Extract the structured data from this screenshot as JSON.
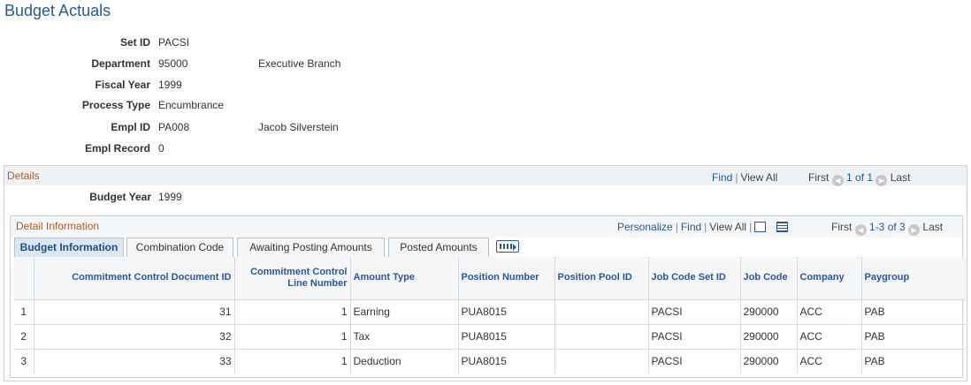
{
  "page": {
    "title": "Budget Actuals"
  },
  "fields": [
    {
      "label": "Set ID",
      "value": "PACSI",
      "desc": ""
    },
    {
      "label": "Department",
      "value": "95000",
      "desc": "Executive Branch"
    },
    {
      "label": "Fiscal Year",
      "value": "1999",
      "desc": ""
    },
    {
      "label": "Process Type",
      "value": "Encumbrance",
      "desc": ""
    },
    {
      "label": "Empl ID",
      "value": "PA008",
      "desc": "Jacob Silverstein"
    },
    {
      "label": "Empl Record",
      "value": "0",
      "desc": ""
    }
  ],
  "details": {
    "title": "Details",
    "find": "Find",
    "view_all": "View All",
    "first": "First",
    "range": "1 of 1",
    "last": "Last",
    "budget_year_label": "Budget Year",
    "budget_year_value": "1999"
  },
  "detail_info": {
    "title": "Detail Information",
    "personalize": "Personalize",
    "find": "Find",
    "view_all": "View All",
    "first": "First",
    "range": "1-3 of 3",
    "last": "Last"
  },
  "tabs": [
    {
      "label": "Budget Information",
      "active": true
    },
    {
      "label": "Combination Code",
      "active": false
    },
    {
      "label": "Awaiting Posting Amounts",
      "active": false
    },
    {
      "label": "Posted Amounts",
      "active": false
    }
  ],
  "table": {
    "headers": [
      "",
      "Commitment Control Document ID",
      "Commitment Control Line Number",
      "Amount Type",
      "Position Number",
      "Position Pool ID",
      "Job Code Set ID",
      "Job Code",
      "Company",
      "Paygroup"
    ],
    "rows": [
      [
        "1",
        "31",
        "1",
        "Earning",
        "PUA8015",
        "",
        "PACSI",
        "290000",
        "ACC",
        "PAB"
      ],
      [
        "2",
        "32",
        "1",
        "Tax",
        "PUA8015",
        "",
        "PACSI",
        "290000",
        "ACC",
        "PAB"
      ],
      [
        "3",
        "33",
        "1",
        "Deduction",
        "PUA8015",
        "",
        "PACSI",
        "290000",
        "ACC",
        "PAB"
      ]
    ]
  },
  "icons": {
    "prev": "left-arrow-icon",
    "next": "right-arrow-icon",
    "zoom": "zoom-icon",
    "download": "download-icon",
    "show_all_columns": "show-all-columns-icon"
  },
  "colors": {
    "title": "#245a9a",
    "section": "#b25a1a",
    "link": "#1c5aa6"
  }
}
